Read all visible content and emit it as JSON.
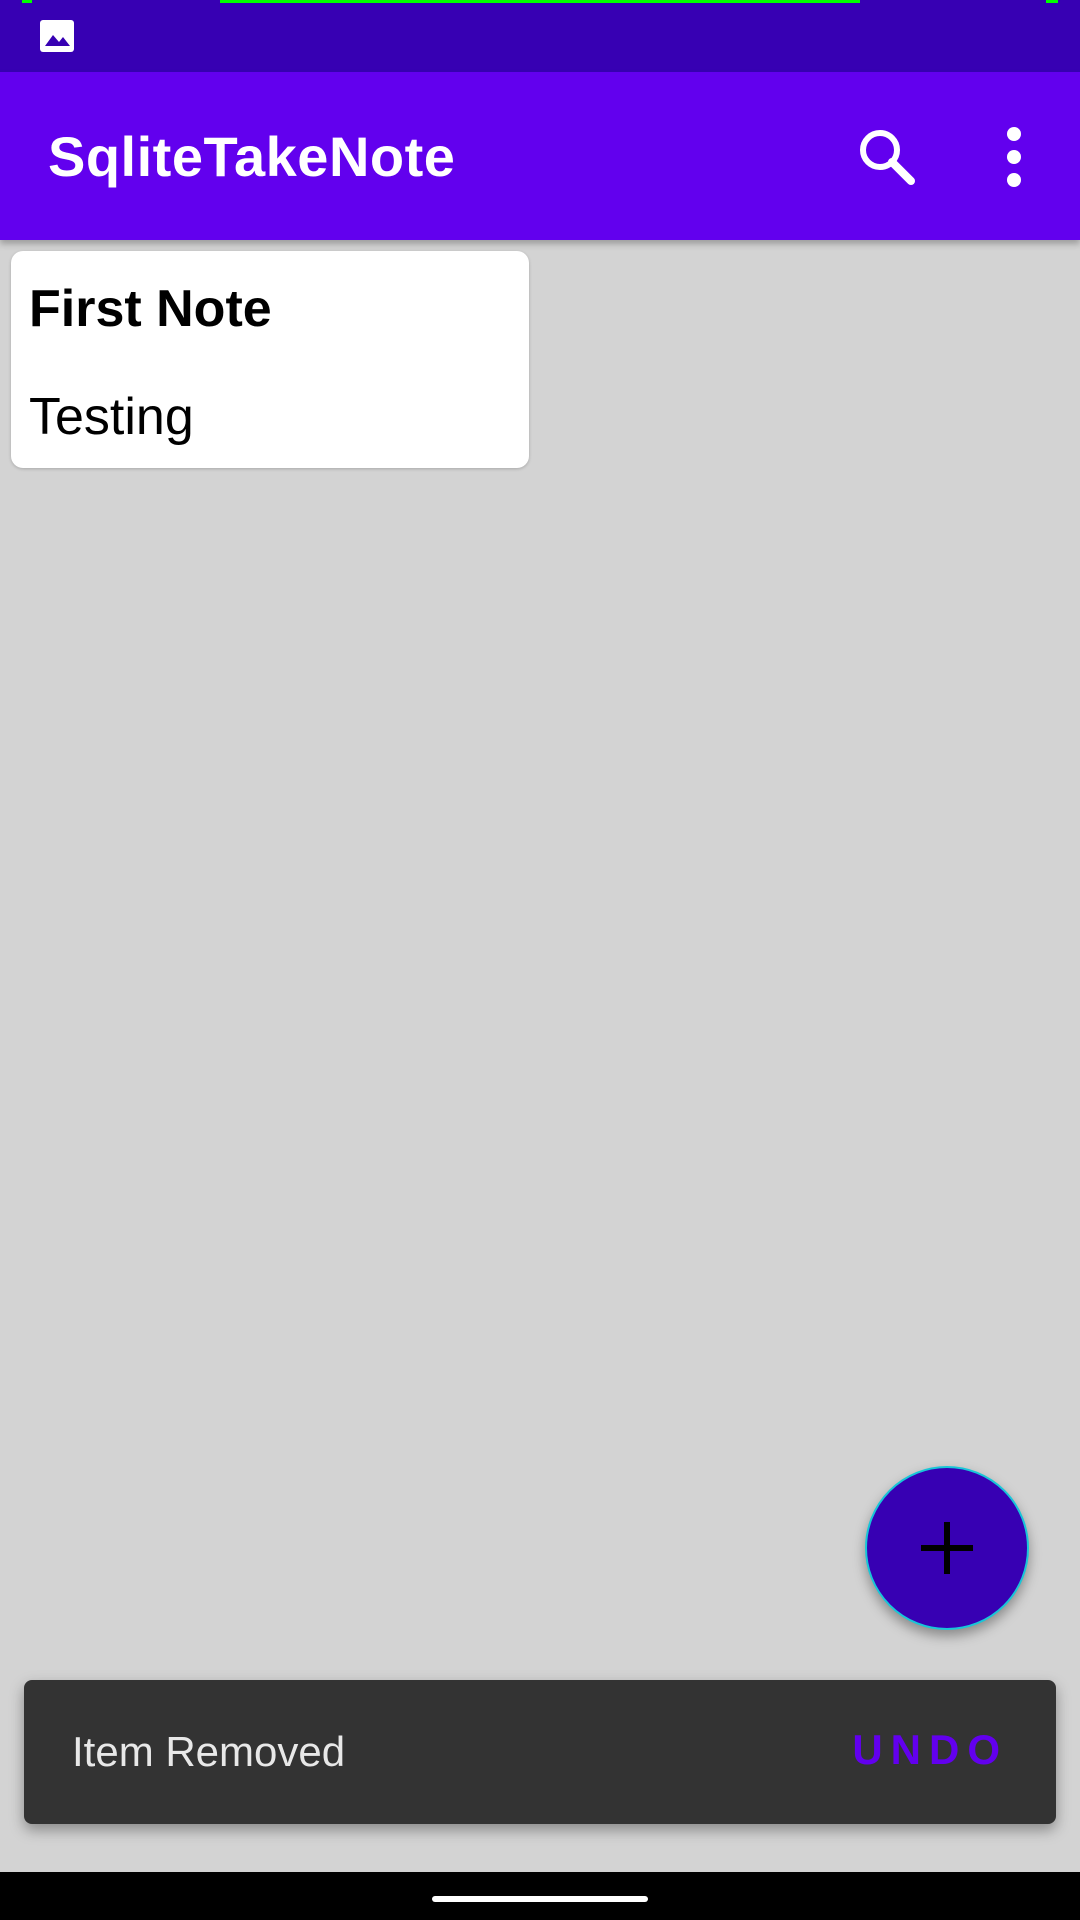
{
  "status_bar": {
    "icons": [
      "image-icon"
    ],
    "colors": {
      "background": "#3700b3",
      "indicator": "#00ff00"
    }
  },
  "app_bar": {
    "title": "SqliteTakeNote",
    "actions": [
      "search-icon",
      "more-vert-icon"
    ],
    "colors": {
      "background": "#6200ee",
      "text": "#ffffff"
    }
  },
  "notes": [
    {
      "title": "First Note",
      "body": "Testing"
    }
  ],
  "fab": {
    "icon": "plus-icon",
    "colors": {
      "background": "#3700b3",
      "border": "#18c6d8",
      "icon": "#000000"
    }
  },
  "snackbar": {
    "message": "Item Removed",
    "action": "UNDO",
    "colors": {
      "background": "#333333",
      "text": "#e8e8e8",
      "action": "#6200ee"
    }
  },
  "colors": {
    "page_background": "#d3d3d3",
    "nav_bar": "#000000"
  }
}
